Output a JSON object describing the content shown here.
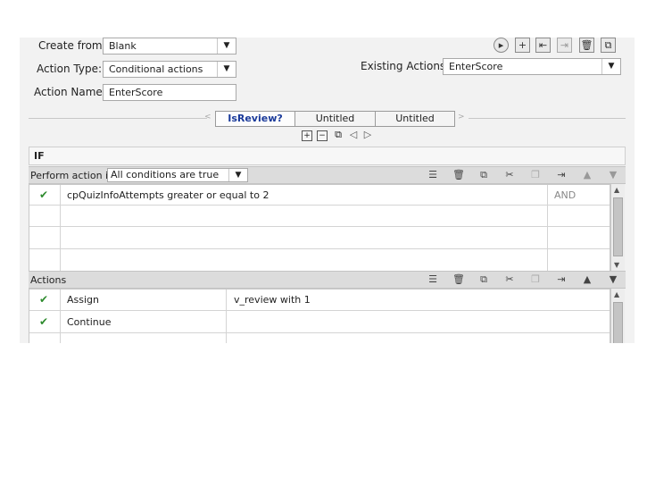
{
  "form": {
    "create_from_label": "Create from:",
    "create_from_value": "Blank",
    "action_type_label": "Action Type:",
    "action_type_value": "Conditional actions",
    "action_name_label": "Action Name:",
    "action_name_value": "EnterScore",
    "existing_actions_label": "Existing Actions:",
    "existing_actions_value": "EnterScore"
  },
  "toolbar": {
    "icons": [
      "play-icon",
      "add-icon",
      "import-icon",
      "export-icon",
      "delete-icon",
      "duplicate-icon"
    ]
  },
  "tabs": [
    {
      "label": "IsReview?",
      "active": true
    },
    {
      "label": "Untitled",
      "active": false
    },
    {
      "label": "Untitled",
      "active": false
    }
  ],
  "tab_controls": [
    "add-tab-icon",
    "remove-tab-icon",
    "copy-tab-icon",
    "prev-tab-icon",
    "next-tab-icon"
  ],
  "if_section": {
    "header": "IF",
    "perform_label": "Perform action if:",
    "perform_value": "All conditions are true",
    "rows": [
      {
        "checked": true,
        "condition": "cpQuizInfoAttempts   greater or equal to   2",
        "operator": "AND"
      },
      {
        "checked": false,
        "condition": "",
        "operator": ""
      },
      {
        "checked": false,
        "condition": "",
        "operator": ""
      },
      {
        "checked": false,
        "condition": "",
        "operator": ""
      }
    ]
  },
  "actions_section": {
    "header": "Actions",
    "rows": [
      {
        "checked": true,
        "action": "Assign",
        "target": "v_review   with   1"
      },
      {
        "checked": true,
        "action": "Continue",
        "target": ""
      },
      {
        "checked": false,
        "action": "",
        "target": ""
      }
    ]
  },
  "row_toolbar_icons": [
    "insert-row-icon",
    "delete-row-icon",
    "copy-row-icon",
    "cut-row-icon",
    "paste-row-icon",
    "indent-row-icon",
    "move-up-icon",
    "move-down-icon"
  ],
  "colors": {
    "check": "#2e8b2e",
    "active_tab_text": "#1a3a9a",
    "panel_bg": "#f2f2f2",
    "section_bar": "#dcdcdc"
  }
}
